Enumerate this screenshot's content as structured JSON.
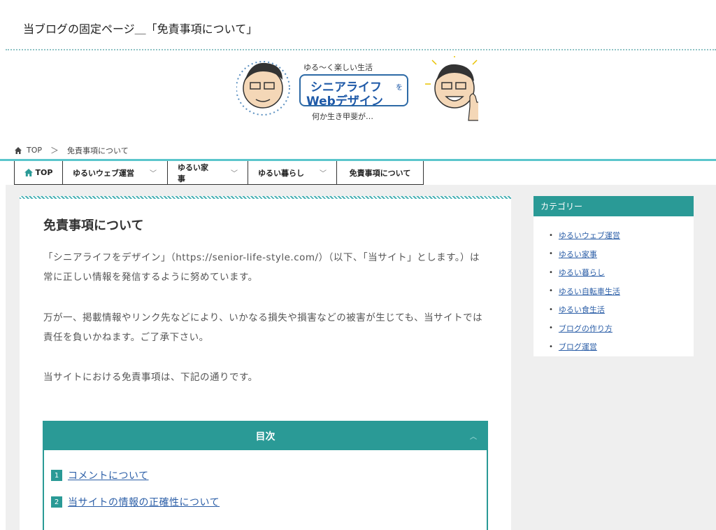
{
  "page_heading": "当ブログの固定ページ＿「免責事項について」",
  "logo": {
    "tagline": "ゆる～く楽しい生活",
    "title_line1": "シニアライフ",
    "title_small": "を",
    "title_line2": "Webデザイン",
    "subline": "何か生き甲斐が…"
  },
  "breadcrumb": {
    "home": "TOP",
    "separator": "＞",
    "current": "免責事項について"
  },
  "nav": {
    "items": [
      {
        "label": "TOP",
        "icon": "home-icon",
        "dropdown": false
      },
      {
        "label": "ゆるいウェブ運営",
        "dropdown": true
      },
      {
        "label": "ゆるい家事",
        "dropdown": true
      },
      {
        "label": "ゆるい暮らし",
        "dropdown": true
      },
      {
        "label": "免責事項について",
        "dropdown": false
      }
    ],
    "chevron": "﹀"
  },
  "article": {
    "title": "免責事項について",
    "p1": "「シニアライフをデザイン」（https://senior-life-style.com/）（以下、「当サイト」とします。）は常に正しい情報を発信するように努めています。",
    "p2": "万が一、掲載情報やリンク先などにより、いかなる損失や損害などの被害が生じても、当サイトでは責任を負いかねます。ご了承下さい。",
    "p3": "当サイトにおける免責事項は、下記の通りです。"
  },
  "toc": {
    "title": "目次",
    "toggle": "︿",
    "items": [
      {
        "num": "1",
        "label": "コメントについて"
      },
      {
        "num": "2",
        "label": "当サイトの情報の正確性について"
      }
    ]
  },
  "sidebar": {
    "title": "カテゴリー",
    "categories": [
      "ゆるいウェブ運営",
      "ゆるい家事",
      "ゆるい暮らし",
      "ゆるい自転車生活",
      "ゆるい食生活",
      "ブログの作り方",
      "ブログ運営"
    ]
  },
  "colors": {
    "accent": "#2a9a96",
    "nav_line": "#5bc6cc",
    "link": "#2b5ea7"
  }
}
